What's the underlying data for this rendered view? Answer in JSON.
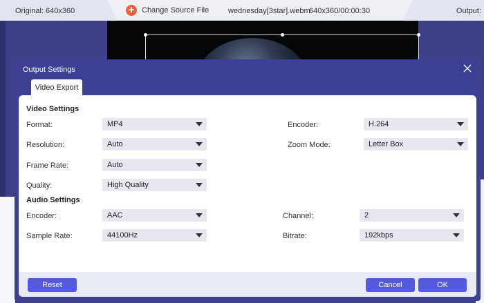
{
  "topbar": {
    "original_label": "Original: 640x360",
    "change_source_label": "Change Source File",
    "filename": "wednesday[3star].webm",
    "fileinfo": "640x360/00:00:30",
    "output_label": "Output:"
  },
  "dialog": {
    "title": "Output Settings",
    "tab_label": "Video Export",
    "video_settings": {
      "heading": "Video Settings",
      "format_label": "Format:",
      "format_value": "MP4",
      "encoder_label": "Encoder:",
      "encoder_value": "H.264",
      "resolution_label": "Resolution:",
      "resolution_value": "Auto",
      "zoom_label": "Zoom Mode:",
      "zoom_value": "Letter Box",
      "framerate_label": "Frame Rate:",
      "framerate_value": "Auto",
      "quality_label": "Quality:",
      "quality_value": "High Quality"
    },
    "audio_settings": {
      "heading": "Audio Settings",
      "encoder_label": "Encoder:",
      "encoder_value": "AAC",
      "channel_label": "Channel:",
      "channel_value": "2",
      "samplerate_label": "Sample Rate:",
      "samplerate_value": "44100Hz",
      "bitrate_label": "Bitrate:",
      "bitrate_value": "192kbps"
    },
    "buttons": {
      "reset": "Reset",
      "cancel": "Cancel",
      "ok": "OK"
    }
  },
  "colors": {
    "accent": "#5559e0",
    "dialog_bg": "#3d3f93",
    "change_source_icon": "#f0623d"
  }
}
